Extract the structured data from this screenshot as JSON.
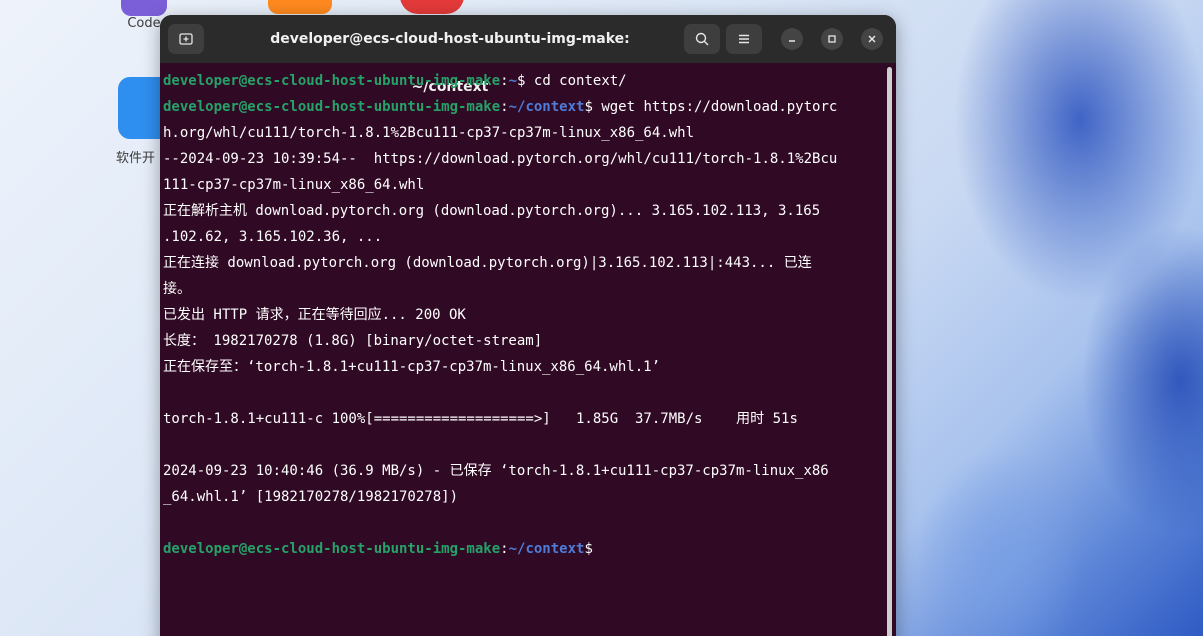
{
  "desktop": {
    "icons": [
      {
        "label": "Code",
        "color": "#7a5fd8"
      },
      {
        "label": "",
        "color": "#ff8a1f"
      },
      {
        "label": "",
        "color": "#e43a3a"
      },
      {
        "label": "软件开",
        "color": "#2f8ff0"
      }
    ]
  },
  "terminal": {
    "title": "developer@ecs-cloud-host-ubuntu-img-make: ~/context",
    "user_host": "developer@ecs-cloud-host-ubuntu-img-make",
    "colors": {
      "background": "#300a24",
      "user": "#26a269",
      "path": "#4d7cd9",
      "text": "#ffffff"
    },
    "lines": [
      {
        "user": "developer@ecs-cloud-host-ubuntu-img-make",
        "sep": ":",
        "path": "~",
        "sym": "$ ",
        "cmd": "cd context/"
      },
      {
        "user": "developer@ecs-cloud-host-ubuntu-img-make",
        "sep": ":",
        "path": "~/context",
        "sym": "$ ",
        "cmd": "wget https://download.pytorc"
      },
      {
        "text": "h.org/whl/cu111/torch-1.8.1%2Bcu111-cp37-cp37m-linux_x86_64.whl"
      },
      {
        "text": "--2024-09-23 10:39:54--  https://download.pytorch.org/whl/cu111/torch-1.8.1%2Bcu"
      },
      {
        "text": "111-cp37-cp37m-linux_x86_64.whl"
      },
      {
        "text": "正在解析主机 download.pytorch.org (download.pytorch.org)... 3.165.102.113, 3.165"
      },
      {
        "text": ".102.62, 3.165.102.36, ..."
      },
      {
        "text": "正在连接 download.pytorch.org (download.pytorch.org)|3.165.102.113|:443... 已连"
      },
      {
        "text": "接。"
      },
      {
        "text": "已发出 HTTP 请求，正在等待回应... 200 OK"
      },
      {
        "text": "长度： 1982170278 (1.8G) [binary/octet-stream]"
      },
      {
        "text": "正在保存至：‘torch-1.8.1+cu111-cp37-cp37m-linux_x86_64.whl.1’"
      },
      {
        "text": ""
      },
      {
        "text": "torch-1.8.1+cu111-c 100%[===================>]   1.85G  37.7MB/s    用时 51s"
      },
      {
        "text": ""
      },
      {
        "text": "2024-09-23 10:40:46 (36.9 MB/s) - 已保存 ‘torch-1.8.1+cu111-cp37-cp37m-linux_x86"
      },
      {
        "text": "_64.whl.1’ [1982170278/1982170278])"
      },
      {
        "text": ""
      },
      {
        "user": "developer@ecs-cloud-host-ubuntu-img-make",
        "sep": ":",
        "path": "~/context",
        "sym": "$",
        "cmd": ""
      }
    ]
  }
}
